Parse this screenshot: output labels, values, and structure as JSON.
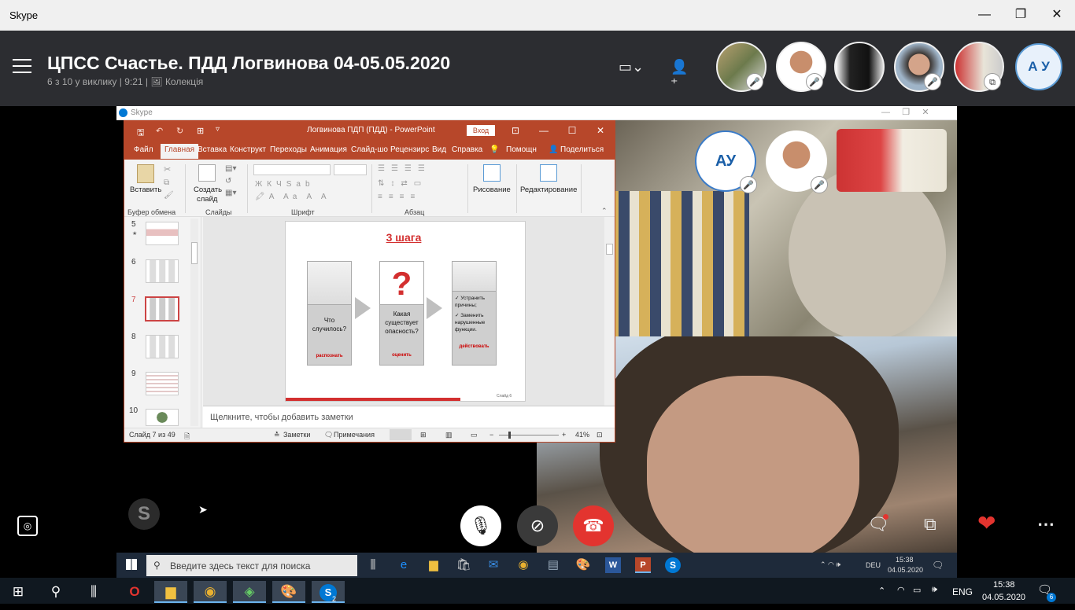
{
  "window": {
    "title": "Skype"
  },
  "call": {
    "title": "ЦПСС Счастье. ПДД Логвинова 04-05.05.2020",
    "subtitle": "6 з 10 у виклику | 9:21",
    "collection": "Колекція",
    "me_initials": "А У"
  },
  "shared": {
    "skype_title": "Skype",
    "inner_me_initials": "АУ"
  },
  "ppt": {
    "title": "Логвинова ПДП (ПДД)  -  PowerPoint",
    "login": "Вход",
    "tabs": [
      "Файл",
      "Главная",
      "Вставка",
      "Конструкт",
      "Переходы",
      "Анимация",
      "Слайд-шо",
      "Рецензирс",
      "Вид",
      "Справка",
      "Помощн",
      "Поделиться"
    ],
    "ribbon": {
      "paste": "Вставить",
      "new_slide_1": "Создать",
      "new_slide_2": "слайд",
      "drawing": "Рисование",
      "editing": "Редактирование",
      "groups": [
        "Буфер обмена",
        "Слайды",
        "Шрифт",
        "Абзац"
      ]
    },
    "thumb_numbers": [
      "5",
      "6",
      "7",
      "8",
      "9",
      "10"
    ],
    "slide": {
      "title": "3 шага",
      "step1": "Что случилось?",
      "step1_tag": "распознать",
      "step2": "Какая существует опасность?",
      "step2_tag": "оценить",
      "step3_a": "✓ Устранить причины;",
      "step3_b": "✓ Заменить нарушенные функции.",
      "step3_tag": "действовать",
      "footer": "Слайд 6"
    },
    "notes_placeholder": "Щелкните, чтобы добавить заметки",
    "status": {
      "slide_of": "Слайд 7 из 49",
      "notes": "Заметки",
      "comments": "Примечания",
      "zoom": "41%"
    }
  },
  "inner_taskbar": {
    "search_placeholder": "Введите здесь текст для поиска",
    "lang": "DEU",
    "time": "15:38",
    "date": "04.05.2020"
  },
  "taskbar": {
    "lang": "ENG",
    "time": "15:38",
    "date": "04.05.2020",
    "skype_badge": "2",
    "notif_badge": "6"
  },
  "colors": {
    "header_bg": "#2c2d31",
    "ppt_accent": "#b7472a",
    "end_call": "#e3342f",
    "skype_blue": "#0078d4"
  }
}
